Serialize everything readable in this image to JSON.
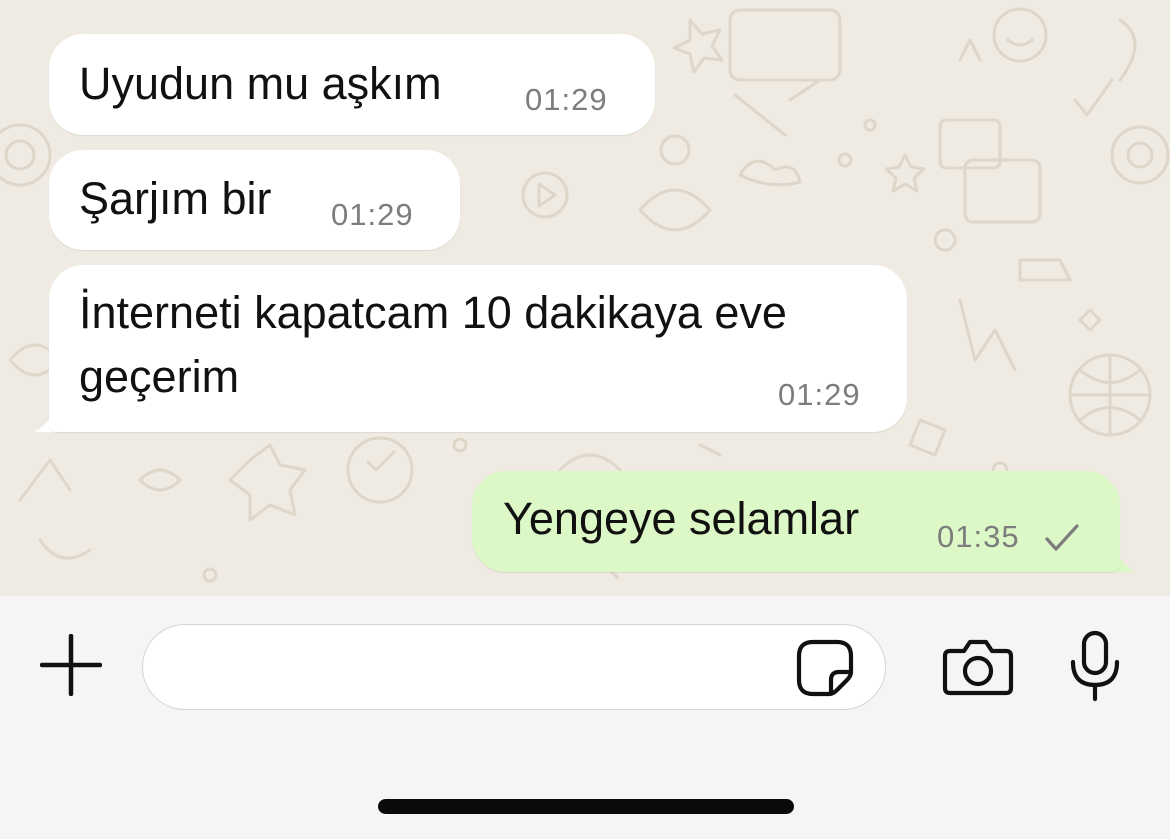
{
  "messages": [
    {
      "direction": "incoming",
      "text": "Uyudun mu aşkım",
      "time": "01:29"
    },
    {
      "direction": "incoming",
      "text": "Şarjım bir",
      "time": "01:29"
    },
    {
      "direction": "incoming",
      "text_line1": "İnterneti kapatcam 10 dakikaya eve",
      "text_line2": "geçerim",
      "time": "01:29"
    },
    {
      "direction": "outgoing",
      "text": "Yengeye selamlar",
      "time": "01:35",
      "status_icon": "single-check-icon"
    }
  ],
  "composer": {
    "input_value": "",
    "input_placeholder": "",
    "attach_icon": "plus-icon",
    "sticker_icon": "sticker-icon",
    "camera_icon": "camera-icon",
    "mic_icon": "microphone-icon"
  },
  "colors": {
    "chat_background": "#efeae2",
    "incoming_bubble": "#ffffff",
    "outgoing_bubble": "#dcf8c6",
    "timestamp": "#7d7d7d",
    "composer_background": "#f6f5f3"
  }
}
